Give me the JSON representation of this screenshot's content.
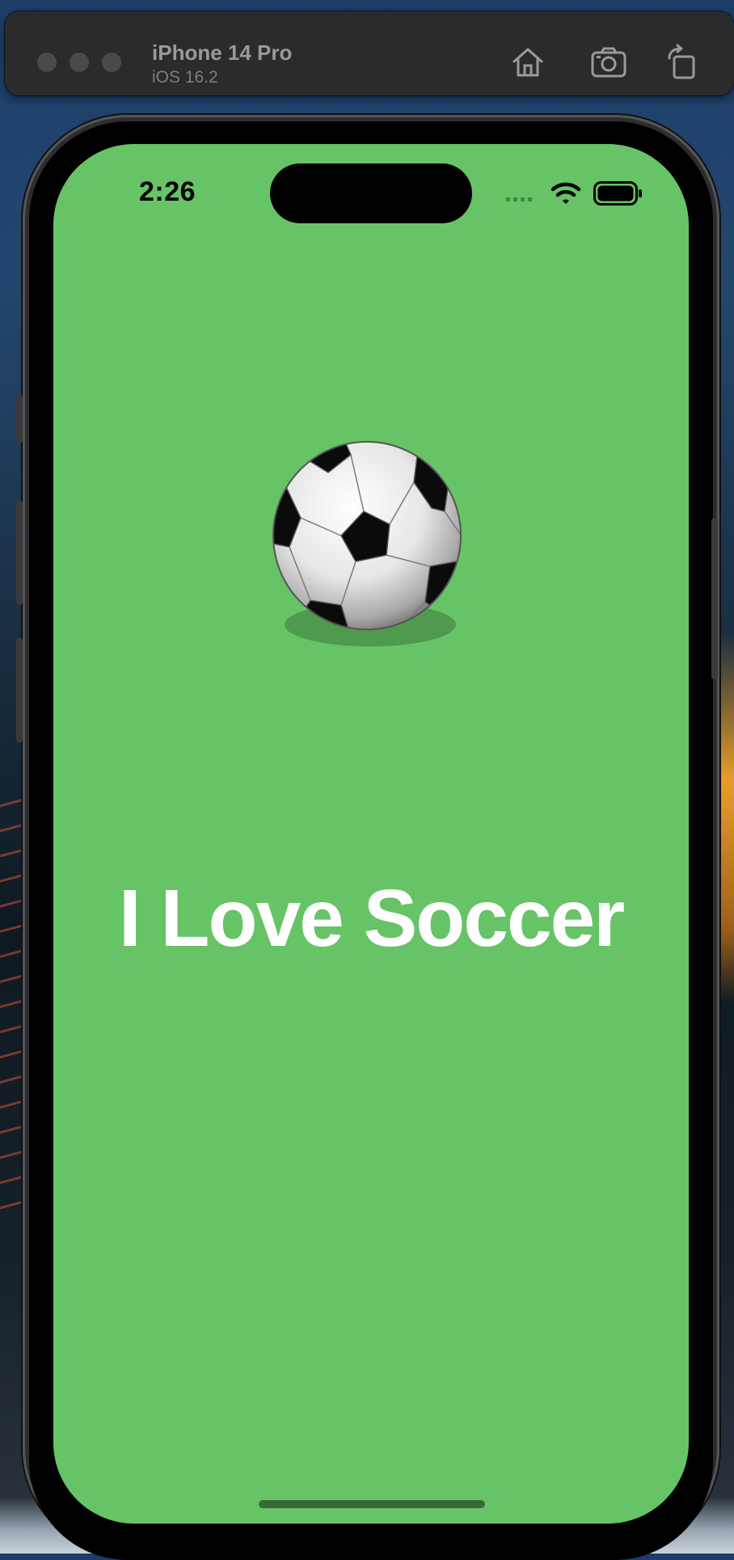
{
  "simulator": {
    "device_name": "iPhone 14 Pro",
    "os_version": "iOS 16.2",
    "toolbar": [
      "home-icon",
      "screenshot-icon",
      "rotate-icon"
    ]
  },
  "status_bar": {
    "time": "2:26",
    "icons": [
      "cellular-icon",
      "wifi-icon",
      "battery-icon"
    ]
  },
  "app": {
    "background_color": "#66c466",
    "image": "soccer-ball",
    "headline": "I Love Soccer",
    "headline_color": "#ffffff"
  }
}
